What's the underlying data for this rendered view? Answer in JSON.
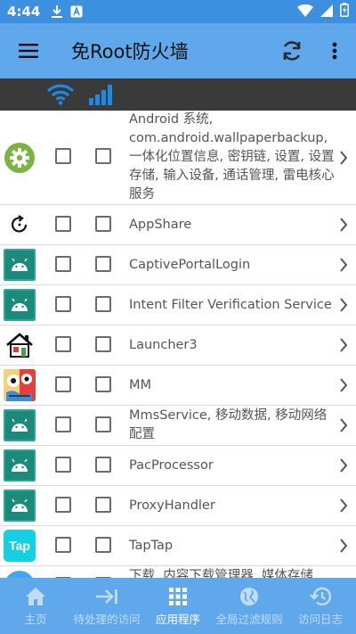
{
  "status_bar": {
    "time": "4:44"
  },
  "app_bar": {
    "title": "免Root防火墙"
  },
  "colors": {
    "primary": "#5fa8ec",
    "status_bar": "#3d8fe0",
    "filter_bar": "#3a3a3a",
    "filter_icon": "#1e88e5"
  },
  "apps": [
    {
      "name": "Android 系统, com.android.wallpaperbackup, 一体化位置信息, 密钥链, 设置, 设置存储, 输入设备, 通话管理, 雷电核心服务",
      "icon": "gear-icon"
    },
    {
      "name": "AppShare",
      "icon": "appshare-icon"
    },
    {
      "name": "CaptivePortalLogin",
      "icon": "android-icon"
    },
    {
      "name": "Intent Filter Verification Service",
      "icon": "android-icon"
    },
    {
      "name": "Launcher3",
      "icon": "house-icon"
    },
    {
      "name": "MM",
      "icon": "mm-icon"
    },
    {
      "name": "MmsService, 移动数据, 移动网络配置",
      "icon": "android-icon"
    },
    {
      "name": "PacProcessor",
      "icon": "android-icon"
    },
    {
      "name": "ProxyHandler",
      "icon": "android-icon"
    },
    {
      "name": "TapTap",
      "icon": "taptap-icon",
      "icon_text": "Tap"
    },
    {
      "name": "下载, 内容下载管理器, 媒体存储",
      "icon": "download-icon"
    }
  ],
  "bottom_nav": {
    "items": [
      {
        "label": "主页",
        "icon": "home-icon"
      },
      {
        "label": "待处理的访问",
        "icon": "arrow-right-bar-icon"
      },
      {
        "label": "应用程序",
        "icon": "grid-icon"
      },
      {
        "label": "全局过滤规则",
        "icon": "globe-icon"
      },
      {
        "label": "访问日志",
        "icon": "history-icon"
      }
    ],
    "active_index": 2
  }
}
